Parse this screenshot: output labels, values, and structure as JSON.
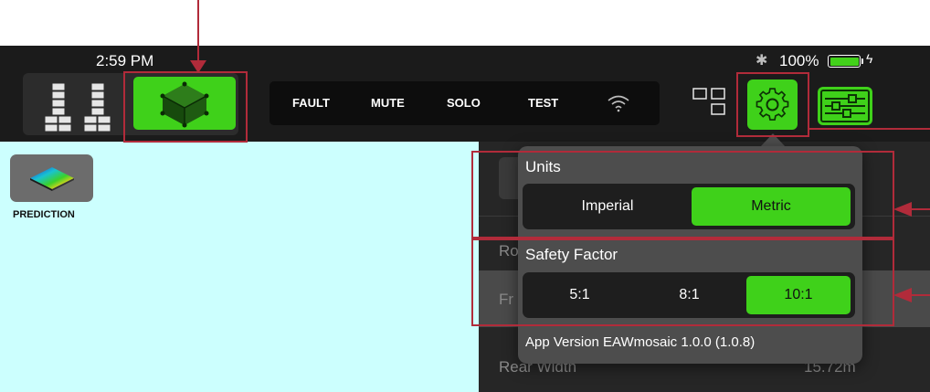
{
  "status_bar": {
    "time": "2:59 PM",
    "battery": "100%"
  },
  "toolbar": {
    "pill_buttons": [
      "FAULT",
      "MUTE",
      "SOLO",
      "TEST"
    ]
  },
  "canvas": {
    "prediction_label": "PREDICTION"
  },
  "background_panel": {
    "row1": "Ro",
    "row2": "Fr",
    "row3_label": "Rear Width",
    "row3_value": "15.72m"
  },
  "settings_popover": {
    "units_title": "Units",
    "units_options": [
      "Imperial",
      "Metric"
    ],
    "units_selected": "Metric",
    "safety_title": "Safety Factor",
    "safety_options": [
      "5:1",
      "8:1",
      "10:1"
    ],
    "safety_selected": "10:1",
    "app_version": "App Version EAWmosaic 1.0.0 (1.0.8)"
  },
  "colors": {
    "accent_green": "#3fd11a",
    "annotation_red": "#b12b3a",
    "canvas_cyan": "#ccfffe"
  }
}
